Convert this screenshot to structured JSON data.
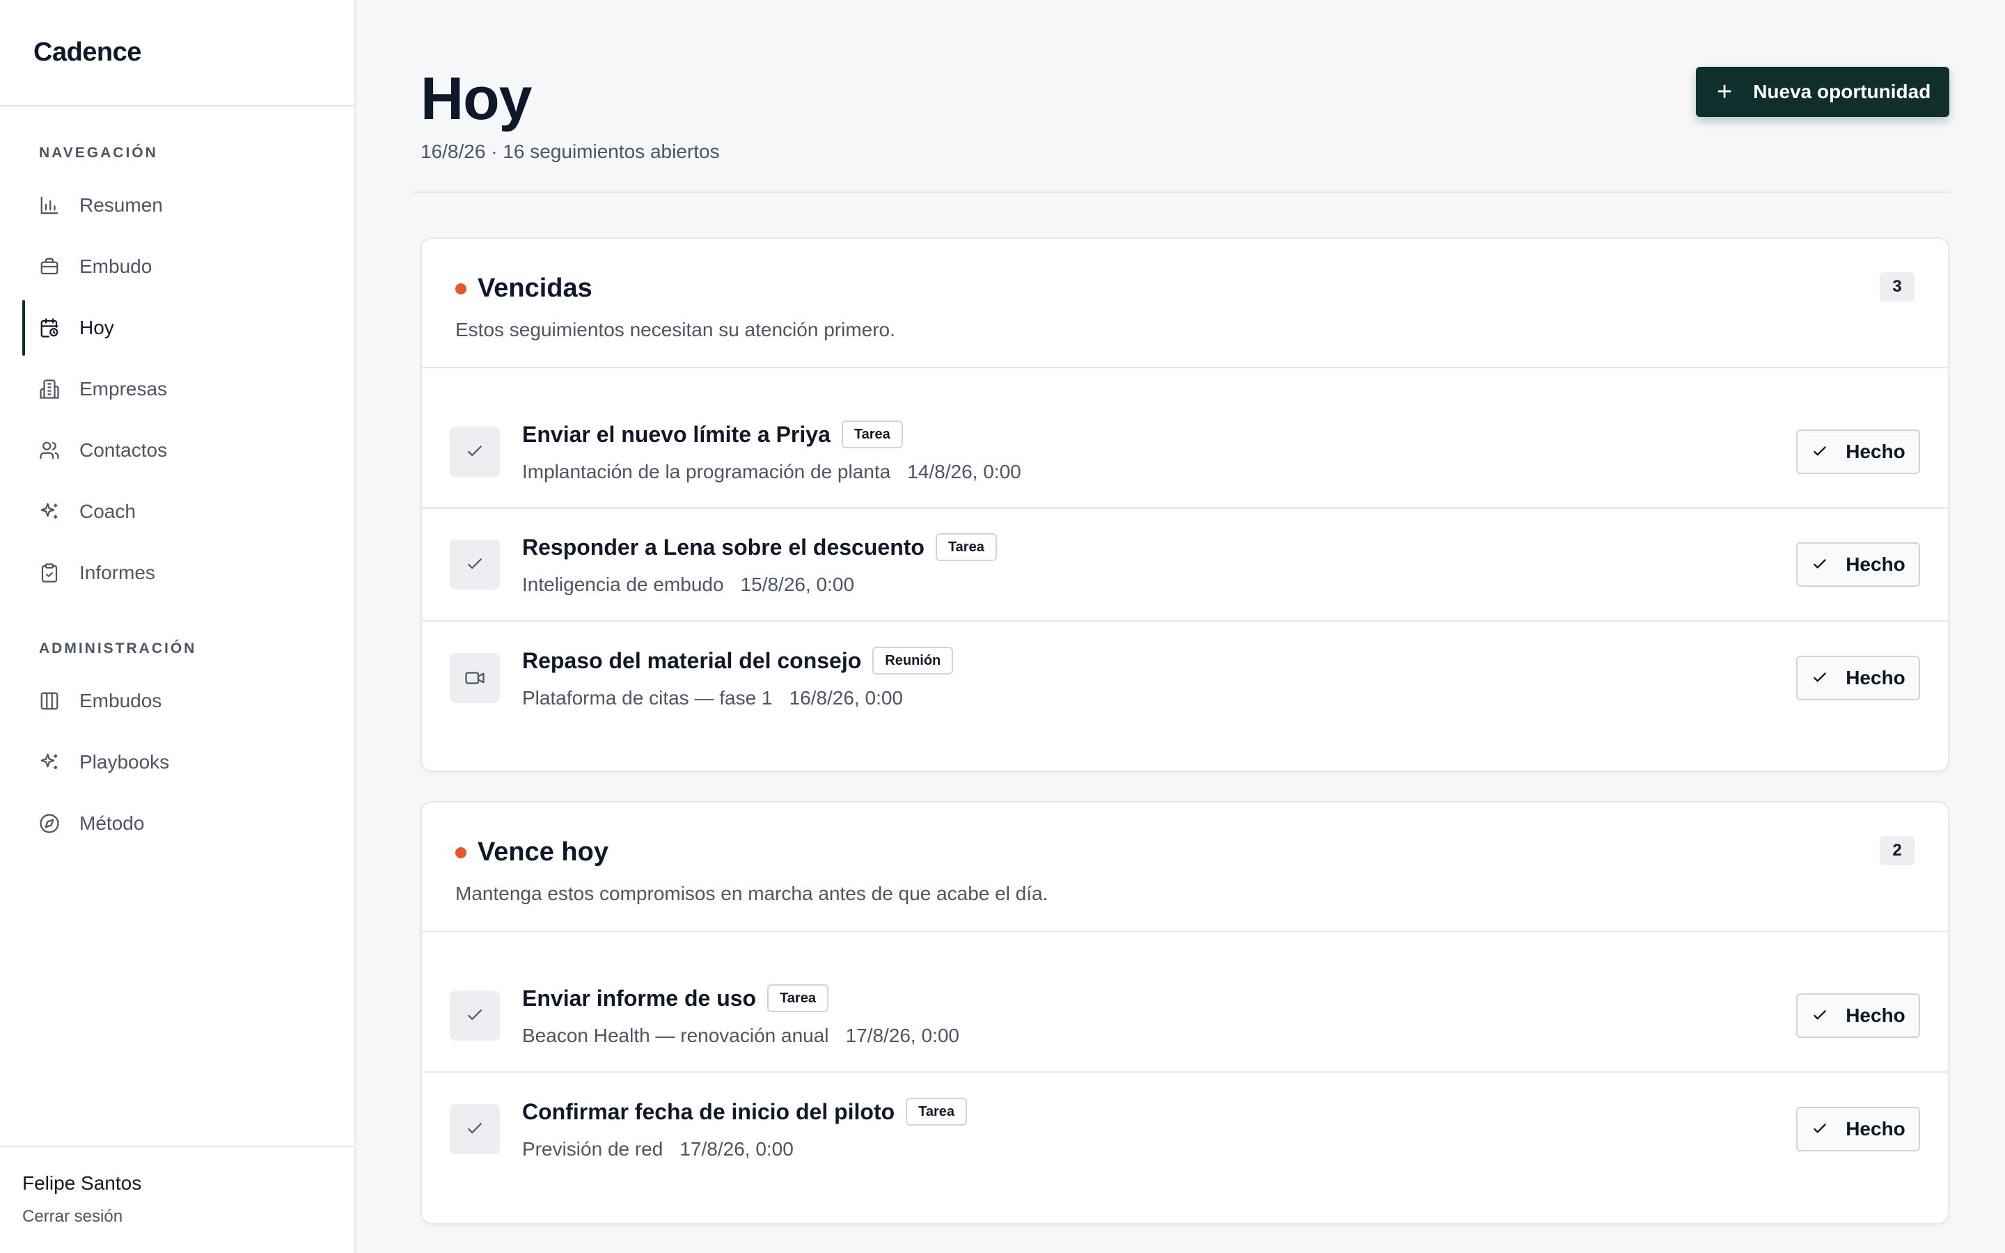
{
  "brand": {
    "name": "Cadence"
  },
  "nav": {
    "section_title": "NAVEGACIÓN",
    "items": [
      {
        "label": "Resumen",
        "icon": "bar-chart-icon"
      },
      {
        "label": "Embudo",
        "icon": "briefcase-icon"
      },
      {
        "label": "Hoy",
        "icon": "calendar-clock-icon",
        "active": true
      },
      {
        "label": "Empresas",
        "icon": "building-icon"
      },
      {
        "label": "Contactos",
        "icon": "users-icon"
      },
      {
        "label": "Coach",
        "icon": "sparkles-icon"
      },
      {
        "label": "Informes",
        "icon": "clipboard-check-icon"
      }
    ]
  },
  "admin": {
    "section_title": "ADMINISTRACIÓN",
    "items": [
      {
        "label": "Embudos",
        "icon": "columns-icon"
      },
      {
        "label": "Playbooks",
        "icon": "sparkles-icon"
      },
      {
        "label": "Método",
        "icon": "compass-icon"
      }
    ]
  },
  "user": {
    "name": "Felipe Santos",
    "logout": "Cerrar sesión"
  },
  "header": {
    "title": "Hoy",
    "subtitle": "16/8/26 · 16 seguimientos abiertos",
    "new_button": "Nueva oportunidad"
  },
  "colors": {
    "primary": "#0f2e2c",
    "accent_dot": "#e4572e"
  },
  "sections": [
    {
      "title": "Vencidas",
      "description": "Estos seguimientos necesitan su atención primero.",
      "count": "3",
      "rows": [
        {
          "title": "Enviar el nuevo límite a Priya",
          "tag": "Tarea",
          "context": "Implantación de la programación de planta",
          "date": "14/8/26, 0:00",
          "icon": "check-icon",
          "done": "Hecho"
        },
        {
          "title": "Responder a Lena sobre el descuento",
          "tag": "Tarea",
          "context": "Inteligencia de embudo",
          "date": "15/8/26, 0:00",
          "icon": "check-icon",
          "done": "Hecho"
        },
        {
          "title": "Repaso del material del consejo",
          "tag": "Reunión",
          "context": "Plataforma de citas — fase 1",
          "date": "16/8/26, 0:00",
          "icon": "video-icon",
          "done": "Hecho"
        }
      ]
    },
    {
      "title": "Vence hoy",
      "description": "Mantenga estos compromisos en marcha antes de que acabe el día.",
      "count": "2",
      "rows": [
        {
          "title": "Enviar informe de uso",
          "tag": "Tarea",
          "context": "Beacon Health — renovación anual",
          "date": "17/8/26, 0:00",
          "icon": "check-icon",
          "done": "Hecho"
        },
        {
          "title": "Confirmar fecha de inicio del piloto",
          "tag": "Tarea",
          "context": "Previsión de red",
          "date": "17/8/26, 0:00",
          "icon": "check-icon",
          "done": "Hecho"
        }
      ]
    }
  ]
}
